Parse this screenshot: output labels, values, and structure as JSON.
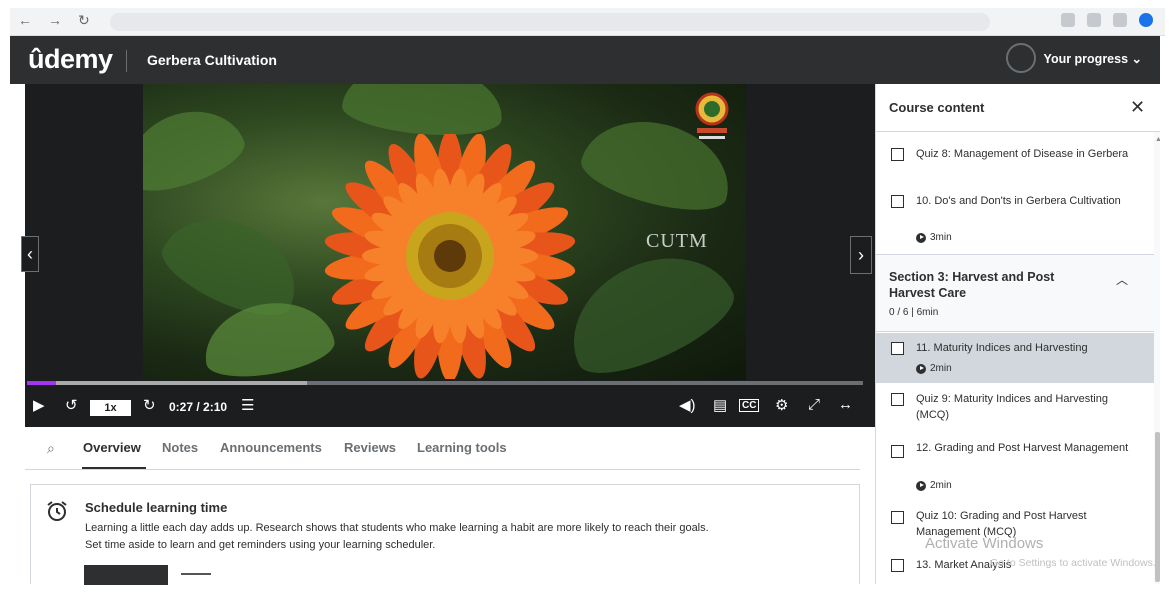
{
  "header": {
    "logo": "ûdemy",
    "course_title": "Gerbera Cultivation",
    "progress_label": "Your progress ⌄"
  },
  "video": {
    "overlay_text": "CUTM",
    "speed": "1x",
    "time": "0:27 / 2:10",
    "progress_fraction": 0.035,
    "buffer_fraction": 0.335,
    "accent_color": "#a435f0"
  },
  "tabs": {
    "items": [
      "Overview",
      "Notes",
      "Announcements",
      "Reviews",
      "Learning tools"
    ],
    "active": "Overview"
  },
  "schedule": {
    "title": "Schedule learning time",
    "body_line1": "Learning a little each day adds up. Research shows that students who make learning a habit are more likely to reach their goals.",
    "body_line2": "Set time aside to learn and get reminders using your learning scheduler."
  },
  "sidebar": {
    "title": "Course content",
    "close": "✕",
    "items_before": [
      {
        "label": "Quiz 8: Management of Disease in Gerbera"
      },
      {
        "label": "10. Do's and Don'ts in Gerbera Cultivation",
        "duration": "3min"
      }
    ],
    "section": {
      "title": "Section 3: Harvest and Post Harvest Care",
      "meta": "0 / 6 | 6min"
    },
    "items_after": [
      {
        "label": "11. Maturity Indices and Harvesting",
        "duration": "2min"
      },
      {
        "label": "Quiz 9: Maturity Indices and Harvesting (MCQ)"
      },
      {
        "label": "12. Grading and Post Harvest Management",
        "duration": "2min"
      },
      {
        "label": "Quiz 10: Grading and Post Harvest Management (MCQ)"
      },
      {
        "label": "13. Market Analysis"
      }
    ]
  },
  "watermark": {
    "title": "Activate Windows",
    "subtitle": "Go to Settings to activate Windows."
  }
}
